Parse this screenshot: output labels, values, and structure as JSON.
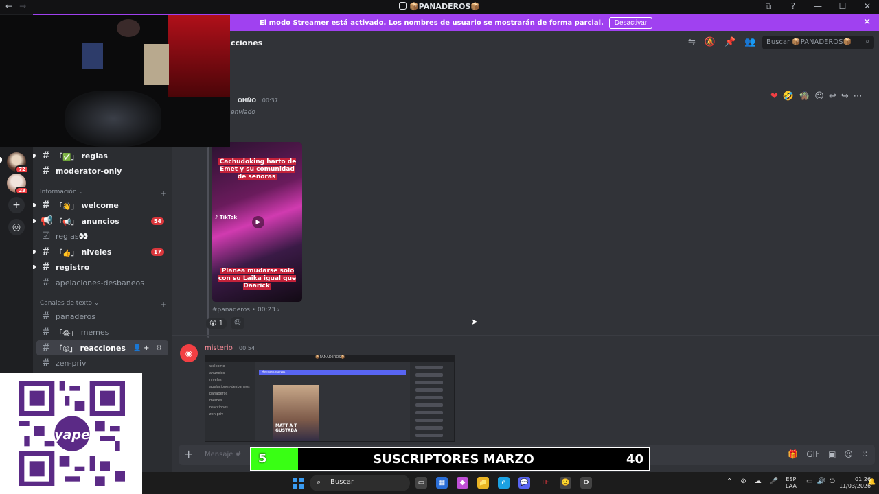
{
  "window": {
    "back": "←",
    "forward": "→",
    "title": "📦PANADEROS📦",
    "controls": [
      "⧉",
      "?",
      "—",
      "☐",
      "✕"
    ]
  },
  "banner": {
    "message": "El modo Streamer está activado. Los nombres de usuario se mostrarán de forma parcial.",
    "button": "Desactivar",
    "close": "✕"
  },
  "rail": {
    "servers": [
      {
        "badge": "72"
      },
      {
        "badge": "23"
      }
    ],
    "add": "+",
    "explore": "◎"
  },
  "sidebar": {
    "channels_top": [
      {
        "emoji": "「✅」",
        "name": "reglas"
      },
      {
        "emoji": "",
        "name": "moderator-only"
      }
    ],
    "category_info": {
      "label": "Información ⌄",
      "plus": "+"
    },
    "info_channels": [
      {
        "emoji": "「👋」",
        "name": "welcome"
      },
      {
        "emoji": "「📢」",
        "name": "anuncios",
        "count": "54"
      },
      {
        "emoji": "",
        "name": "reglas👀"
      },
      {
        "emoji": "「👍」",
        "name": "niveles",
        "count": "17"
      },
      {
        "emoji": "",
        "name": "registro"
      },
      {
        "emoji": "",
        "name": "apelaciones-desbaneos"
      }
    ],
    "category_text": {
      "label": "Canales de texto ⌄",
      "plus": "+"
    },
    "text_channels": [
      {
        "emoji": "",
        "name": "panaderos"
      },
      {
        "emoji": "「😂」",
        "name": "memes"
      },
      {
        "emoji": "「😡」",
        "name": "reacciones",
        "tools": "👤+ ⚙"
      },
      {
        "emoji": "",
        "name": "zen-priv"
      }
    ],
    "settings": "⚙"
  },
  "chat": {
    "channel_name": "cciones",
    "header_icons": [
      "⇋",
      "🔕",
      "📌",
      "👥"
    ],
    "search_placeholder": "Buscar 📦PANADEROS📦",
    "hover_reactions": [
      "❤",
      "🤣",
      "🧌",
      "☺",
      "↩",
      "↪",
      "⋯"
    ],
    "msg1": {
      "author": "OHÑO",
      "time": "00:37",
      "forwarded": "enviado",
      "video": {
        "caption_top": "Cachudoking harto de Emet y su comunidad de señoras",
        "caption_bottom": "Planea mudarse solo con su Laika igual que Daarick",
        "tiktok": "♪ TikTok",
        "play": "▶"
      },
      "source": "#panaderos • 00:23 ›",
      "reaction": {
        "emoji": "😲",
        "count": "1"
      },
      "add_reaction": "☺"
    },
    "msg2": {
      "author": "misterio",
      "time": "00:54",
      "shot": {
        "title": "📦PANADEROS📦",
        "channels": [
          "welcome",
          "anuncios",
          "niveles",
          "apelaciones-desbaneos",
          "panaderos",
          "memes",
          "reacciones",
          "zen-priv"
        ],
        "banner": "Mensajes nuevos",
        "image_caption": "MATT A T GUSTABA"
      }
    },
    "composer_placeholder": "Mensaje #",
    "composer_plus": "+",
    "composer_icons": [
      "🎁",
      "GIF",
      "▣",
      "☺",
      "⁙"
    ]
  },
  "overlay": {
    "subs_current": "5",
    "subs_label": "SUSCRIPTORES MARZO",
    "subs_goal": "40"
  },
  "taskbar": {
    "search": "Buscar",
    "apps": [
      "▭",
      "▦",
      "◆",
      "📁",
      "e",
      "💬",
      "TF",
      "🙂",
      "⚙"
    ],
    "tray": [
      "⌃",
      "⊘",
      "☁",
      "🎤"
    ],
    "lang": "ESP",
    "lang2": "LAA",
    "sys": [
      "▭",
      "🔊",
      "⏻"
    ],
    "time": "01:26",
    "date": "11/03/2026",
    "notif": "🔔"
  },
  "colors": {
    "banner": "#a041f0",
    "sub_bar": "#39ff14",
    "mention_badge": "#da373c"
  }
}
